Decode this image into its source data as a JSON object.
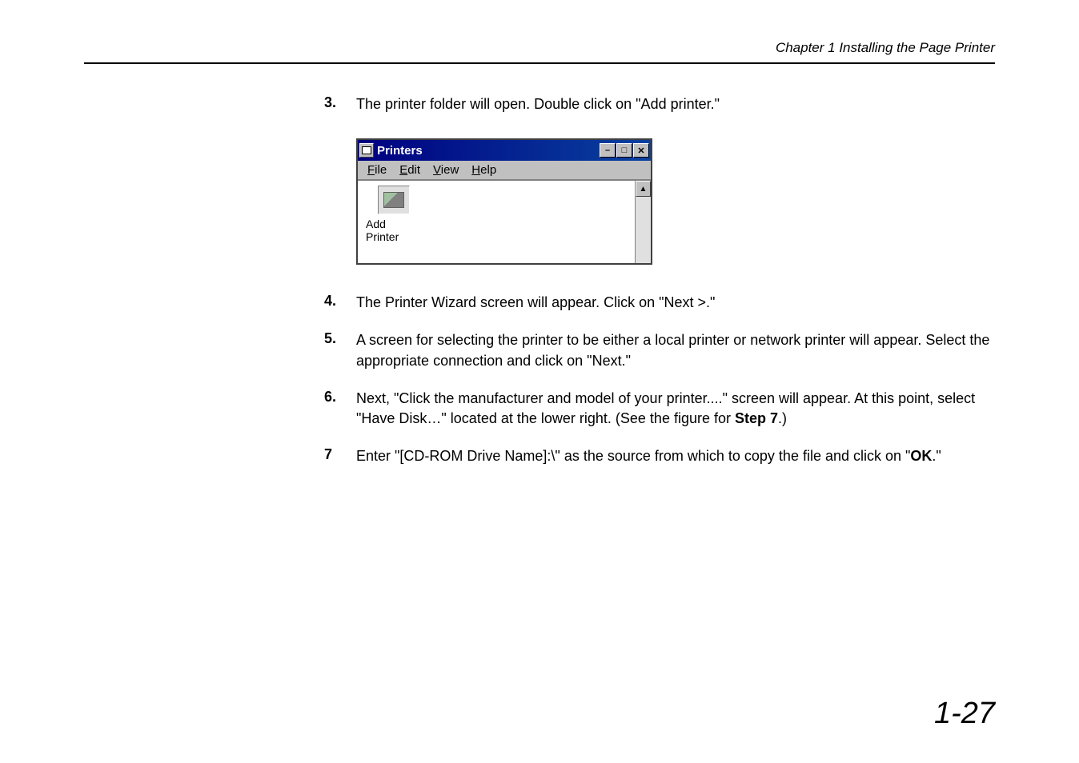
{
  "header": {
    "chapter": "Chapter 1  Installing the Page Printer"
  },
  "steps": {
    "s3": {
      "num": "3.",
      "text": "The printer folder will open.  Double click on \"Add printer.\""
    },
    "s4": {
      "num": "4.",
      "text": "The Printer Wizard screen will appear.  Click on \"Next >.\""
    },
    "s5": {
      "num": "5.",
      "text": "A screen for selecting the printer to be either a local printer or network printer will appear. Select the appropriate connection and click on \"Next.\""
    },
    "s6": {
      "num": "6.",
      "text_a": "Next, \"Click the manufacturer and model of your printer....\" screen will appear.  At this point, select \"Have Disk…\" located at the lower right.  (See the figure for ",
      "text_b": "Step 7",
      "text_c": ".)"
    },
    "s7": {
      "num": "7",
      "text_a": "Enter \"[CD-ROM Drive Name]:\\\" as the source from which to copy the file and click on \"",
      "text_b": "OK",
      "text_c": ".\""
    }
  },
  "window": {
    "title": "Printers",
    "menu": {
      "file": "File",
      "edit": "Edit",
      "view": "View",
      "help": "Help"
    },
    "icon_label": "Add Printer",
    "buttons": {
      "minimize": "–",
      "maximize": "□",
      "close": "✕"
    },
    "scroll_up": "▲"
  },
  "page_number": "1-27"
}
